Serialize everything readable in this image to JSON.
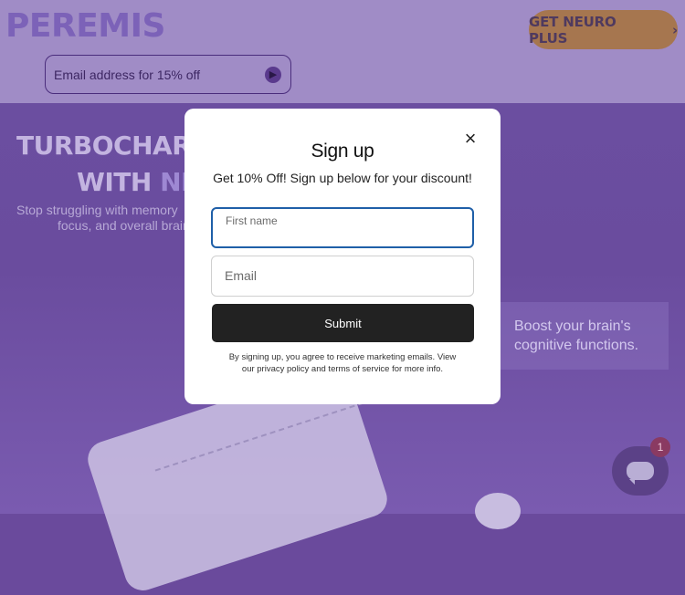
{
  "header": {
    "logo_text": "PEREMIS",
    "cta_label": "GET NEURO PLUS",
    "cta_chevron": "›",
    "email_placeholder": "Email address for 15% off",
    "email_submit_icon": "arrow-right-icon"
  },
  "hero": {
    "title_line1": "TURBOCHARGE YO",
    "title_line2_prefix": "WITH ",
    "title_line2_accent": "NEURO",
    "subtitle_line1": "Stop struggling with memory",
    "subtitle_line2": "focus, and overall brain",
    "callout_line1": "Boost your brain's",
    "callout_line2": "cognitive functions."
  },
  "chat": {
    "badge_count": "1"
  },
  "modal": {
    "close_glyph": "×",
    "title": "Sign up",
    "subtitle": "Get 10% Off! Sign up below for your discount!",
    "first_name_label": "First name",
    "email_label": "Email",
    "submit_label": "Submit",
    "disclaimer_line1": "By signing up, you agree to receive marketing emails. View",
    "disclaimer_line2": "our privacy policy and terms of service for more info."
  },
  "colors": {
    "overlay_purple": "#6a4a9c",
    "header_purple": "#a08cc6",
    "cta_bronze": "#a6764f",
    "input_focus_blue": "#1f5fa8",
    "submit_black": "#222222"
  }
}
